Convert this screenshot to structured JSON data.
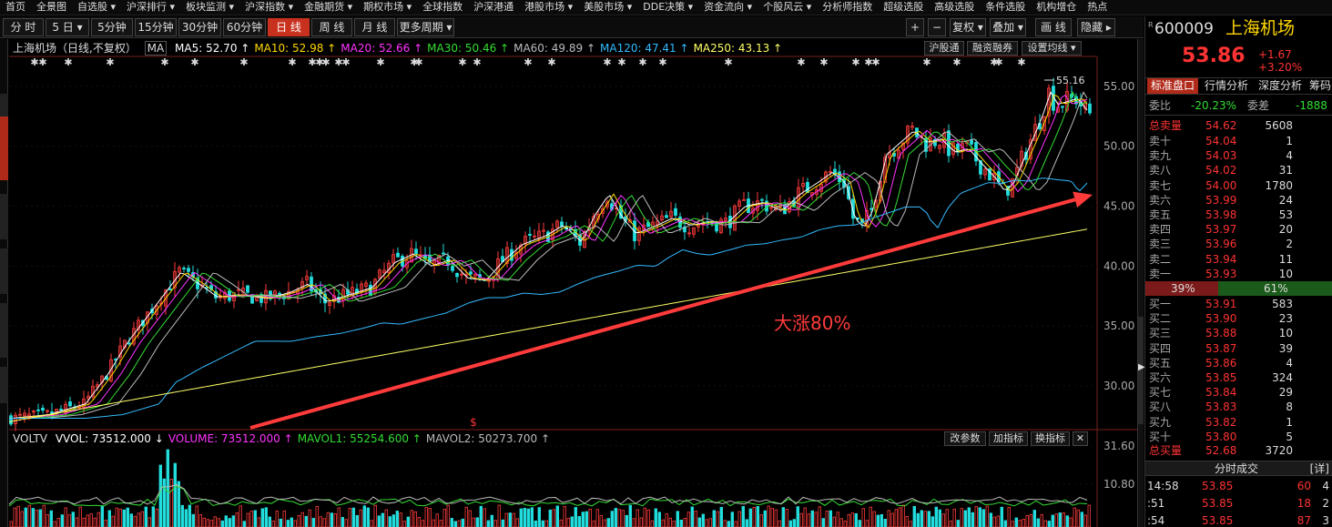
{
  "menu": [
    "首页",
    "全景图",
    "自选股 ▾",
    "沪深排行 ▾",
    "板块监测 ▾",
    "沪深指数 ▾",
    "金融期货 ▾",
    "期权市场 ▾",
    "全球指数",
    "沪深港通",
    "港股市场 ▾",
    "美股市场 ▾",
    "DDE决策 ▾",
    "资金流向 ▾",
    "个股风云 ▾",
    "分析师指数",
    "超级选股",
    "高级选股",
    "条件选股",
    "机构增仓",
    "热点"
  ],
  "periods": [
    "分 时",
    "5 日 ▾",
    "5分钟",
    "15分钟",
    "30分钟",
    "60分钟",
    "日 线",
    "周 线",
    "月 线",
    "更多周期 ▾"
  ],
  "active_period": "日 线",
  "right_tools": [
    "+",
    "−",
    "复权 ▾",
    "叠加 ▾",
    "画 线",
    "隐藏 ▸"
  ],
  "legend": {
    "stock": "上海机场（日线,不复权）",
    "ma_tag": "MA",
    "items": [
      {
        "text": "MA5: 52.70",
        "color": "#ffffff"
      },
      {
        "text": "MA10: 52.98",
        "color": "#ffd700"
      },
      {
        "text": "MA20: 52.66",
        "color": "#ff33ff"
      },
      {
        "text": "MA30: 50.46",
        "color": "#33dd33"
      },
      {
        "text": "MA60: 49.89",
        "color": "#bbbbbb"
      },
      {
        "text": "MA120: 47.41",
        "color": "#33bbff"
      },
      {
        "text": "MA250: 43.13",
        "color": "#ffff66"
      }
    ]
  },
  "chart_buttons": [
    "沪股通",
    "融资融券",
    "设置均线 ▾"
  ],
  "annotation": "大涨80%",
  "max_label": "55.16",
  "signal_mark": "$",
  "price_axis": [
    "55.00",
    "50.00",
    "45.00",
    "40.00",
    "35.00",
    "30.00"
  ],
  "volume": {
    "name": "VOLTV",
    "items": [
      {
        "text": "VVOL: 73512.000 ↓",
        "color": "#ffffff"
      },
      {
        "text": "VOLUME: 73512.000 ↑",
        "color": "#ff33ff"
      },
      {
        "text": "MAVOL1: 55254.600 ↑",
        "color": "#33dd33"
      },
      {
        "text": "MAVOL2: 50273.700 ↑",
        "color": "#bbbbbb"
      }
    ],
    "buttons": [
      "改参数",
      "加指标",
      "换指标",
      "✕"
    ],
    "axis": [
      "31.60",
      "10.80"
    ]
  },
  "quote": {
    "code": "600009",
    "name": "上海机场",
    "price": "53.86",
    "change": "+1.67",
    "pct": "+3.20%",
    "tabs": [
      "标准盘口",
      "行情分析",
      "深度分析",
      "筹码"
    ],
    "webi_label": "委比",
    "webi": "-20.23%",
    "weicha_label": "委差",
    "weicha": "-1888",
    "total_sell_label": "总卖量",
    "total_sell_price": "54.62",
    "total_sell_vol": "5608",
    "sells": [
      {
        "l": "卖十",
        "p": "54.04",
        "v": "1"
      },
      {
        "l": "卖九",
        "p": "54.03",
        "v": "4"
      },
      {
        "l": "卖八",
        "p": "54.02",
        "v": "31"
      },
      {
        "l": "卖七",
        "p": "54.00",
        "v": "1780"
      },
      {
        "l": "卖六",
        "p": "53.99",
        "v": "24"
      },
      {
        "l": "卖五",
        "p": "53.98",
        "v": "53"
      },
      {
        "l": "卖四",
        "p": "53.97",
        "v": "20"
      },
      {
        "l": "卖三",
        "p": "53.96",
        "v": "2"
      },
      {
        "l": "卖二",
        "p": "53.94",
        "v": "11"
      },
      {
        "l": "卖一",
        "p": "53.93",
        "v": "10"
      }
    ],
    "buy_ratio": "39%",
    "sell_ratio": "61%",
    "buys": [
      {
        "l": "买一",
        "p": "53.91",
        "v": "583"
      },
      {
        "l": "买二",
        "p": "53.90",
        "v": "23"
      },
      {
        "l": "买三",
        "p": "53.88",
        "v": "10"
      },
      {
        "l": "买四",
        "p": "53.87",
        "v": "39"
      },
      {
        "l": "买五",
        "p": "53.86",
        "v": "4"
      },
      {
        "l": "买六",
        "p": "53.85",
        "v": "324"
      },
      {
        "l": "买七",
        "p": "53.84",
        "v": "29"
      },
      {
        "l": "买八",
        "p": "53.83",
        "v": "8"
      },
      {
        "l": "买九",
        "p": "53.82",
        "v": "1"
      },
      {
        "l": "买十",
        "p": "53.80",
        "v": "5"
      }
    ],
    "total_buy_label": "总买量",
    "total_buy_price": "52.68",
    "total_buy_vol": "3720",
    "ticks_title": "分时成交",
    "ticks_detail": "[详]",
    "ticks": [
      {
        "t": "14:58",
        "p": "53.85",
        "v": "60",
        "n": "4"
      },
      {
        "t": ":51",
        "p": "53.85",
        "v": "18",
        "n": "2"
      },
      {
        "t": ":54",
        "p": "53.85",
        "v": "87",
        "n": "3"
      }
    ]
  },
  "chart_data": {
    "type": "candlestick",
    "ylim": [
      26.5,
      56.5
    ],
    "y_ticks": [
      55,
      50,
      45,
      40,
      35,
      30
    ],
    "trend": [
      [
        0,
        27.3
      ],
      [
        40,
        27.6
      ],
      [
        80,
        28.5
      ],
      [
        105,
        31
      ],
      [
        125,
        33.5
      ],
      [
        145,
        35.5
      ],
      [
        165,
        37.5
      ],
      [
        185,
        39.5
      ],
      [
        205,
        38.5
      ],
      [
        225,
        37.4
      ],
      [
        250,
        37.6
      ],
      [
        280,
        37.3
      ],
      [
        305,
        37.8
      ],
      [
        325,
        38.5
      ],
      [
        345,
        37
      ],
      [
        370,
        37.6
      ],
      [
        395,
        38.2
      ],
      [
        420,
        40.3
      ],
      [
        440,
        41
      ],
      [
        460,
        40
      ],
      [
        480,
        40.5
      ],
      [
        500,
        39
      ],
      [
        520,
        38.8
      ],
      [
        540,
        40.5
      ],
      [
        560,
        41.8
      ],
      [
        585,
        42.5
      ],
      [
        605,
        43.4
      ],
      [
        625,
        42
      ],
      [
        640,
        44.3
      ],
      [
        655,
        46
      ],
      [
        670,
        44
      ],
      [
        685,
        42.7
      ],
      [
        705,
        43.3
      ],
      [
        725,
        44
      ],
      [
        745,
        43.4
      ],
      [
        765,
        43.7
      ],
      [
        785,
        43.6
      ],
      [
        805,
        45
      ],
      [
        825,
        45.3
      ],
      [
        845,
        44.6
      ],
      [
        865,
        46
      ],
      [
        885,
        47
      ],
      [
        900,
        47.8
      ],
      [
        915,
        47
      ],
      [
        925,
        44
      ],
      [
        935,
        43.2
      ],
      [
        945,
        44.7
      ],
      [
        960,
        49.3
      ],
      [
        975,
        50.3
      ],
      [
        990,
        51.3
      ],
      [
        1005,
        50.3
      ],
      [
        1020,
        50.6
      ],
      [
        1035,
        49.5
      ],
      [
        1050,
        49.8
      ],
      [
        1065,
        48.5
      ],
      [
        1080,
        47.3
      ],
      [
        1090,
        46.2
      ],
      [
        1100,
        47
      ],
      [
        1110,
        48.8
      ],
      [
        1120,
        50.5
      ],
      [
        1130,
        52.3
      ],
      [
        1140,
        54.5
      ],
      [
        1148,
        53.5
      ],
      [
        1158,
        53.7
      ],
      [
        1170,
        54
      ],
      [
        1183,
        52.7
      ]
    ],
    "ma_lag": {
      "MA60": [
        40,
        0.8
      ],
      "MA120": [
        85,
        2.5
      ],
      "MA250": [
        260,
        5.5
      ]
    },
    "arrow": {
      "from": [
        275,
        470
      ],
      "to": [
        1200,
        214
      ]
    }
  }
}
